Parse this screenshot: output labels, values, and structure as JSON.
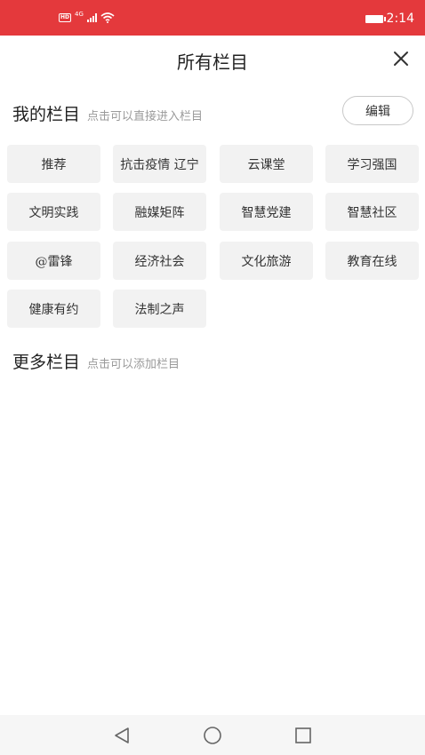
{
  "status_bar": {
    "hd": "HD",
    "network": "4G",
    "time": "2:14"
  },
  "header": {
    "title": "所有栏目",
    "close_icon": "close-icon"
  },
  "my_columns": {
    "title": "我的栏目",
    "hint": "点击可以直接进入栏目",
    "edit_label": "编辑",
    "items": [
      {
        "label": "推荐"
      },
      {
        "label": "抗击疫情 辽宁"
      },
      {
        "label": "云课堂"
      },
      {
        "label": "学习强国"
      },
      {
        "label": "文明实践"
      },
      {
        "label": "融媒矩阵"
      },
      {
        "label": "智慧党建"
      },
      {
        "label": "智慧社区"
      },
      {
        "label": "@雷锋"
      },
      {
        "label": "经济社会"
      },
      {
        "label": "文化旅游"
      },
      {
        "label": "教育在线"
      },
      {
        "label": "健康有约"
      },
      {
        "label": "法制之声"
      }
    ]
  },
  "more_columns": {
    "title": "更多栏目",
    "hint": "点击可以添加栏目"
  },
  "nav_bar": {
    "back_icon": "back-triangle-icon",
    "home_icon": "home-circle-icon",
    "recent_icon": "recent-square-icon"
  },
  "colors": {
    "status_bar": "#e4393c",
    "chip_bg": "#f2f2f2",
    "hint_text": "#9a9a9a"
  }
}
